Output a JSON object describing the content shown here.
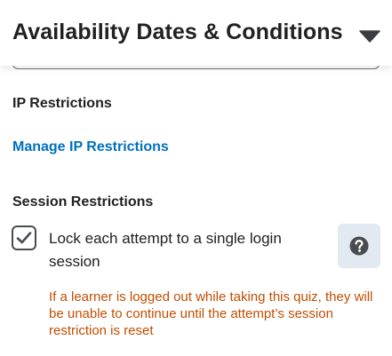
{
  "header": {
    "title": "Availability Dates & Conditions",
    "collapse_icon": "caret-down-icon"
  },
  "ip_restrictions": {
    "heading": "IP Restrictions",
    "link_label": "Manage IP Restrictions"
  },
  "session_restrictions": {
    "heading": "Session Restrictions",
    "checkbox_checked": true,
    "checkbox_label": "Lock each attempt to a single login session",
    "help_icon": "question-circle-icon",
    "warning_text": "If a learner is logged out while taking this quiz, they will be unable to continue until the attempt’s session restriction is reset"
  },
  "colors": {
    "link": "#006fbf",
    "warning": "#c24e00",
    "help_button_bg": "#e3e9f1",
    "text": "#202122"
  }
}
